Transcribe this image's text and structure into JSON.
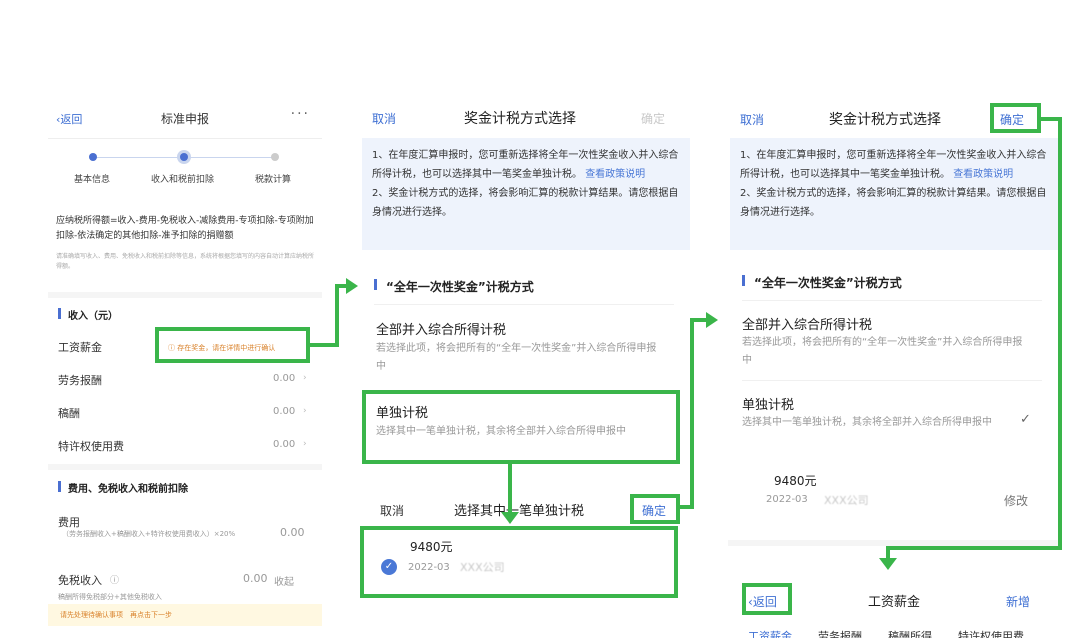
{
  "panel1": {
    "back": "返回",
    "title": "标准申报",
    "more": "···",
    "steps": [
      "基本信息",
      "收入和税前扣除",
      "税款计算"
    ],
    "formula": "应纳税所得额=收入-费用-免税收入-减除费用-专项扣除-专项附加扣除-依法确定的其他扣除-准予扣除的捐赠额",
    "hint": "请准确填写收入、费用、免税收入和税前扣除等信息，系统将根据您填写的内容自动计算应纳税所得额。",
    "income_title": "收入（元）",
    "rows": [
      {
        "label": "工资薪金",
        "value": "",
        "tag": "ⓘ 存在奖金，请在详情中进行确认"
      },
      {
        "label": "劳务报酬",
        "value": "0.00"
      },
      {
        "label": "稿酬",
        "value": "0.00"
      },
      {
        "label": "特许权使用费",
        "value": "0.00"
      }
    ],
    "deduct_title": "费用、免税收入和税前扣除",
    "fee_label": "费用",
    "fee_desc": "（劳务报酬收入+稿酬收入+特许权使用费收入）×20%",
    "fee_value": "0.00",
    "exempt_label": "免税收入",
    "exempt_value": "0.00",
    "collapse": "收起",
    "exempt_desc": "稿酬所得免税部分+其他免税收入",
    "bottom_note": "请先处理待确认事项　再点击下一步"
  },
  "panel2": {
    "cancel": "取消",
    "title": "奖金计税方式选择",
    "confirm": "确定",
    "notice1": "1、在年度汇算申报时，您可重新选择将全年一次性奖金收入并入综合所得计税，也可以选择其中一笔奖金单独计税。",
    "notice_link": "查看政策说明",
    "notice2": "2、奖金计税方式的选择，将会影响汇算的税款计算结果。请您根据自身情况进行选择。",
    "section": "“全年一次性奖金”计税方式",
    "opt1_title": "全部并入综合所得计税",
    "opt1_desc": "若选择此项，将会把所有的“全年一次性奖金”并入综合所得申报中",
    "opt2_title": "单独计税",
    "opt2_desc": "选择其中一笔单独计税，其余将全部并入综合所得申报中",
    "sub_cancel": "取消",
    "sub_title": "选择其中一笔单独计税",
    "sub_confirm": "确定",
    "amount": "9480元",
    "date": "2022-03",
    "company": "XXX公司"
  },
  "panel3": {
    "cancel": "取消",
    "title": "奖金计税方式选择",
    "confirm": "确定",
    "notice1": "1、在年度汇算申报时，您可重新选择将全年一次性奖金收入并入综合所得计税，也可以选择其中一笔奖金单独计税。",
    "notice_link": "查看政策说明",
    "notice2": "2、奖金计税方式的选择，将会影响汇算的税款计算结果。请您根据自身情况进行选择。",
    "section": "“全年一次性奖金”计税方式",
    "opt1_title": "全部并入综合所得计税",
    "opt1_desc": "若选择此项，将会把所有的“全年一次性奖金”并入综合所得申报中",
    "opt2_title": "单独计税",
    "opt2_desc": "选择其中一笔单独计税，其余将全部并入综合所得申报中",
    "check": "✓",
    "amount": "9480元",
    "date": "2022-03",
    "company": "XXX公司",
    "modify": "修改",
    "back": "返回",
    "page_title": "工资薪金",
    "add": "新增",
    "tabs": [
      "工资薪金",
      "劳务报酬",
      "稿酬所得",
      "特许权使用费"
    ]
  },
  "colors": {
    "accent": "#3e6fd3",
    "highlight": "#3ab54a",
    "warning": "#d9822b",
    "notice_bg": "#eef3fc"
  }
}
